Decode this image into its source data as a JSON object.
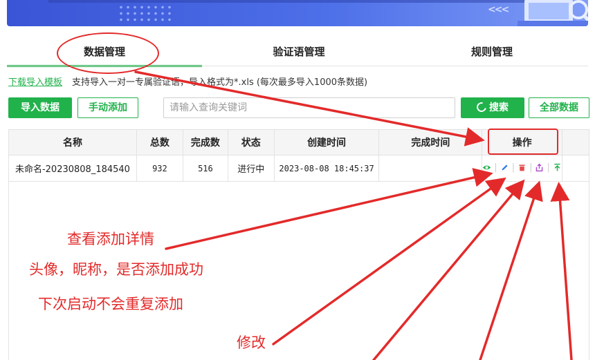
{
  "tabs": [
    {
      "label": "数据管理",
      "active": true
    },
    {
      "label": "验证语管理",
      "active": false
    },
    {
      "label": "规则管理",
      "active": false
    }
  ],
  "info": {
    "template_link": "下载导入模板",
    "description": "支持导入一对一专属验证语，导入格式为*.xls  (每次最多导入1000条数据)"
  },
  "toolbar": {
    "import_label": "导入数据",
    "manual_add_label": "手动添加",
    "search_placeholder": "请输入查询关键词",
    "search_label": "搜索",
    "all_data_label": "全部数据"
  },
  "table": {
    "headers": [
      "名称",
      "总数",
      "完成数",
      "状态",
      "创建时间",
      "完成时间",
      "操作"
    ],
    "rows": [
      {
        "name": "未命名-20230808_184540",
        "total": "932",
        "done": "516",
        "status": "进行中",
        "created": "2023-08-08 18:45:37",
        "finished": ""
      }
    ]
  },
  "annotations": {
    "view_detail": "查看添加详情",
    "avatar_nickname": "头像，昵称，是否添加成功",
    "no_repeat": "下次启动不会重复添加",
    "edit": "修改"
  },
  "colors": {
    "accent": "#21b24b",
    "annotation": "#e32a2a",
    "banner": "#4d6fe8"
  },
  "icons": [
    "eye-icon",
    "pencil-icon",
    "trash-icon",
    "export-icon",
    "top-icon"
  ]
}
